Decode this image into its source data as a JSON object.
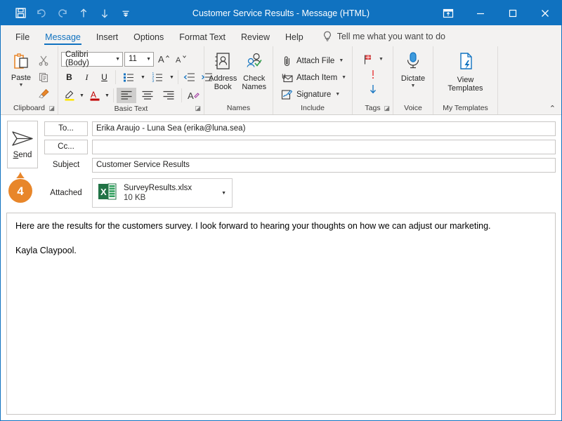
{
  "window": {
    "title": "Customer Service Results - Message (HTML)",
    "accent_color": "#1072c0",
    "ribbon_bg": "#f3f2f1"
  },
  "quick_access": [
    {
      "name": "save-icon",
      "tooltip": "Save"
    },
    {
      "name": "undo-icon",
      "tooltip": "Undo"
    },
    {
      "name": "redo-icon",
      "tooltip": "Redo"
    },
    {
      "name": "previous-item-icon",
      "tooltip": "Previous Item"
    },
    {
      "name": "next-item-icon",
      "tooltip": "Next Item"
    },
    {
      "name": "customize-quick-access-toolbar-icon",
      "tooltip": "Customize Quick Access Toolbar"
    }
  ],
  "window_controls": [
    {
      "name": "ribbon-display-options-icon",
      "label": "Ribbon Display Options"
    },
    {
      "name": "minimize-icon",
      "label": "Minimize"
    },
    {
      "name": "maximize-icon",
      "label": "Maximize"
    },
    {
      "name": "close-icon",
      "label": "Close"
    }
  ],
  "tabs": [
    {
      "label": "File",
      "active": false
    },
    {
      "label": "Message",
      "active": true
    },
    {
      "label": "Insert",
      "active": false
    },
    {
      "label": "Options",
      "active": false
    },
    {
      "label": "Format Text",
      "active": false
    },
    {
      "label": "Review",
      "active": false
    },
    {
      "label": "Help",
      "active": false
    }
  ],
  "tell_me": {
    "label": "Tell me what you want to do",
    "icon": "lightbulb-icon"
  },
  "ribbon": {
    "groups": [
      {
        "label": "Clipboard",
        "has_dialog_launcher": true
      },
      {
        "label": "Basic Text",
        "has_dialog_launcher": true
      },
      {
        "label": "Names",
        "has_dialog_launcher": false
      },
      {
        "label": "Include",
        "has_dialog_launcher": false
      },
      {
        "label": "Tags",
        "has_dialog_launcher": true
      },
      {
        "label": "Voice",
        "has_dialog_launcher": false
      },
      {
        "label": "My Templates",
        "has_dialog_launcher": false
      }
    ],
    "clipboard": {
      "paste_label": "Paste",
      "cut_label": "Cut",
      "copy_label": "Copy",
      "format_painter_label": "Format Painter"
    },
    "basic_text": {
      "font_name": "Calibri (Body)",
      "font_size": "11",
      "grow_font_label": "A",
      "shrink_font_label": "A",
      "bold_label": "B",
      "italic_label": "I",
      "underline_label": "U",
      "bullets_label": "Bullets",
      "numbering_label": "Numbering",
      "decrease_indent_label": "Decrease Indent",
      "increase_indent_label": "Increase Indent",
      "highlight_label": "Text Highlight Color",
      "font_color_label": "Font Color",
      "align_left_label": "Align Left",
      "align_center_label": "Center",
      "align_right_label": "Align Right",
      "clear_formatting_label": "Clear All Formatting"
    },
    "names": {
      "address_book_line1": "Address",
      "address_book_line2": "Book",
      "check_names_line1": "Check",
      "check_names_line2": "Names"
    },
    "include": {
      "attach_file": "Attach File",
      "attach_item": "Attach Item",
      "signature": "Signature"
    },
    "tags": {
      "follow_up_label": "Follow Up",
      "high_importance_label": "High Importance",
      "low_importance_label": "Low Importance"
    },
    "voice": {
      "dictate_label": "Dictate"
    },
    "my_templates": {
      "view_templates_line1": "View",
      "view_templates_line2": "Templates"
    },
    "collapse_ribbon_label": "Collapse the Ribbon"
  },
  "compose": {
    "send_label": "Send",
    "to_button_label": "To...",
    "cc_button_label": "Cc...",
    "subject_label": "Subject",
    "attached_label": "Attached",
    "to_value": "Erika Araujo - Luna Sea (erika@luna.sea)",
    "cc_value": "",
    "subject_value": "Customer Service Results",
    "attachment": {
      "file_name": "SurveyResults.xlsx",
      "file_size": "10 KB",
      "icon": "excel-file-icon",
      "icon_letter": "X",
      "icon_color": "#217346"
    },
    "step_badge": {
      "number": "4",
      "color": "#e8862a"
    },
    "body_paragraphs": [
      "Here are the results for the customers survey. I look forward to hearing your thoughts on how we can adjust our marketing.",
      "Kayla Claypool."
    ]
  }
}
